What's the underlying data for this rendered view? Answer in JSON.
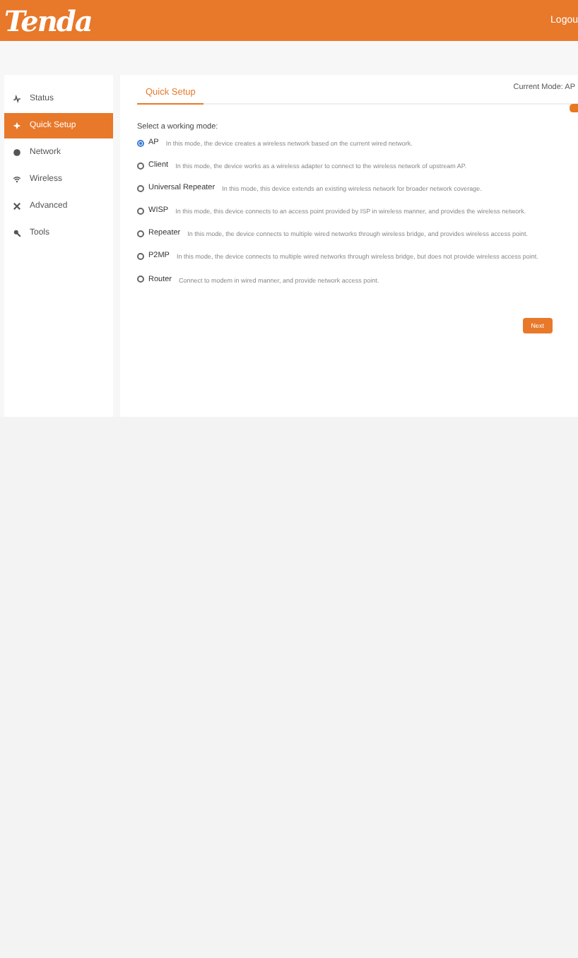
{
  "header": {
    "logo": "Tenda",
    "logout": "Logou"
  },
  "sidebar": {
    "items": [
      {
        "label": "Status",
        "kind": "status",
        "selected": false
      },
      {
        "label": "Quick Setup",
        "kind": "setup",
        "selected": true
      },
      {
        "label": "Network",
        "kind": "network",
        "selected": false
      },
      {
        "label": "Wireless",
        "kind": "wireless",
        "selected": false
      },
      {
        "label": "Advanced",
        "kind": "advanced",
        "selected": false
      },
      {
        "label": "Tools",
        "kind": "tools",
        "selected": false
      }
    ]
  },
  "main": {
    "tab": "Quick Setup",
    "current_mode": "Current Mode: AP",
    "prompt": "Select a working mode:",
    "modes": [
      {
        "name": "AP",
        "description": "In this mode, the device creates a wireless network based on the current wired network.",
        "selected": true
      },
      {
        "name": "Client",
        "description": "In this mode, the device works as a wireless adapter to connect to the wireless network of upstream AP.",
        "selected": false
      },
      {
        "name": "Universal Repeater",
        "description": "In this mode, this device extends an existing wireless network for broader network coverage.",
        "selected": false
      },
      {
        "name": "WISP",
        "description": "In this mode, this device connects to an access point provided by ISP in wireless manner, and provides the wireless network.",
        "selected": false
      },
      {
        "name": "Repeater",
        "description": "In this mode, the device connects to multiple wired networks through wireless bridge, and provides wireless access point.",
        "selected": false
      },
      {
        "name": "P2MP",
        "description": "In this mode, the device connects to multiple wired networks through wireless bridge, but does not provide wireless access point.",
        "selected": false
      },
      {
        "name": "Router",
        "description": "Connect to modem in wired manner, and provide network access point.",
        "selected": false
      }
    ],
    "next_button": "Next"
  }
}
